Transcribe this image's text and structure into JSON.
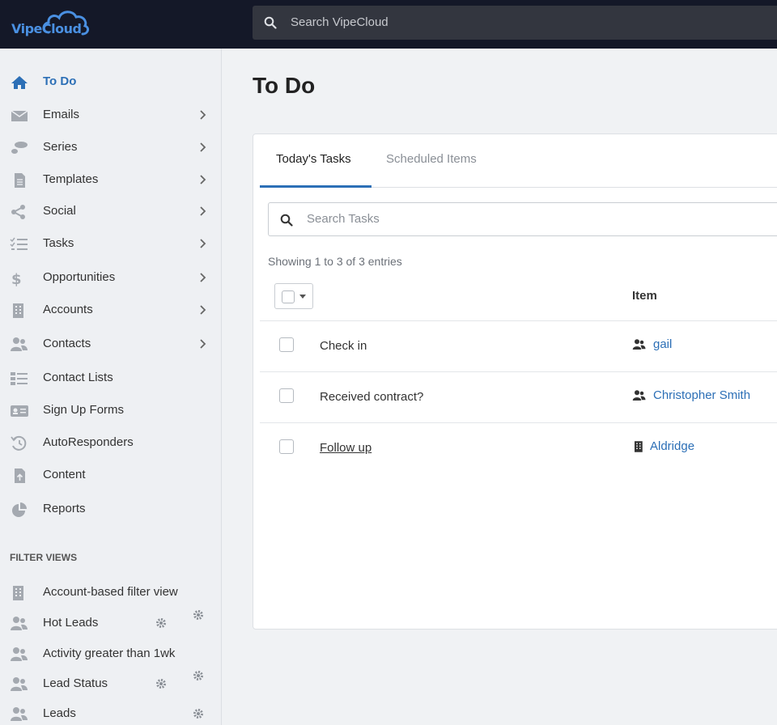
{
  "app": {
    "logo_text": "VipeCloud",
    "search_placeholder": "Search VipeCloud"
  },
  "sidebar": {
    "items": [
      {
        "label": "To Do",
        "icon": "home-icon",
        "active": true,
        "chevron": false
      },
      {
        "label": "Emails",
        "icon": "envelope-icon",
        "chevron": true
      },
      {
        "label": "Series",
        "icon": "footsteps-icon",
        "chevron": true
      },
      {
        "label": "Templates",
        "icon": "document-icon",
        "chevron": true
      },
      {
        "label": "Social",
        "icon": "share-icon",
        "chevron": true
      },
      {
        "label": "Tasks",
        "icon": "tasks-list-icon",
        "chevron": true
      },
      {
        "label": "Opportunities",
        "icon": "dollar-icon",
        "chevron": true
      },
      {
        "label": "Accounts",
        "icon": "building-icon",
        "chevron": true
      },
      {
        "label": "Contacts",
        "icon": "users-icon",
        "chevron": true
      },
      {
        "label": "Contact Lists",
        "icon": "list-icon",
        "chevron": false
      },
      {
        "label": "Sign Up Forms",
        "icon": "id-card-icon",
        "chevron": false
      },
      {
        "label": "AutoResponders",
        "icon": "history-icon",
        "chevron": false
      },
      {
        "label": "Content",
        "icon": "file-upload-icon",
        "chevron": false
      },
      {
        "label": "Reports",
        "icon": "pie-chart-icon",
        "chevron": false
      }
    ],
    "filter_views_heading": "FILTER VIEWS",
    "filter_views": [
      {
        "label": "Account-based filter view",
        "icon": "building-icon"
      },
      {
        "label": "Hot Leads",
        "icon": "users-icon"
      },
      {
        "label": "Activity greater than 1wk",
        "icon": "users-icon"
      },
      {
        "label": "Lead Status",
        "icon": "users-icon"
      },
      {
        "label": "Leads",
        "icon": "users-icon"
      }
    ]
  },
  "main": {
    "title": "To Do",
    "tabs": [
      {
        "label": "Today's Tasks",
        "active": true
      },
      {
        "label": "Scheduled Items",
        "active": false
      }
    ],
    "search_placeholder": "Search Tasks",
    "showing_text": "Showing 1 to 3 of 3 entries",
    "column_item": "Item",
    "rows": [
      {
        "task": "Check in",
        "item": "gail",
        "item_icon": "users-icon",
        "task_link": false
      },
      {
        "task": "Received contract?",
        "item": "Christopher Smith",
        "item_icon": "users-icon",
        "task_link": false
      },
      {
        "task": "Follow up",
        "item": "Aldridge",
        "item_icon": "building-icon",
        "task_link": true
      }
    ]
  },
  "colors": {
    "topbar": "#141828",
    "accent": "#2c6fb6",
    "sidebar_bg": "#eef0f3"
  }
}
